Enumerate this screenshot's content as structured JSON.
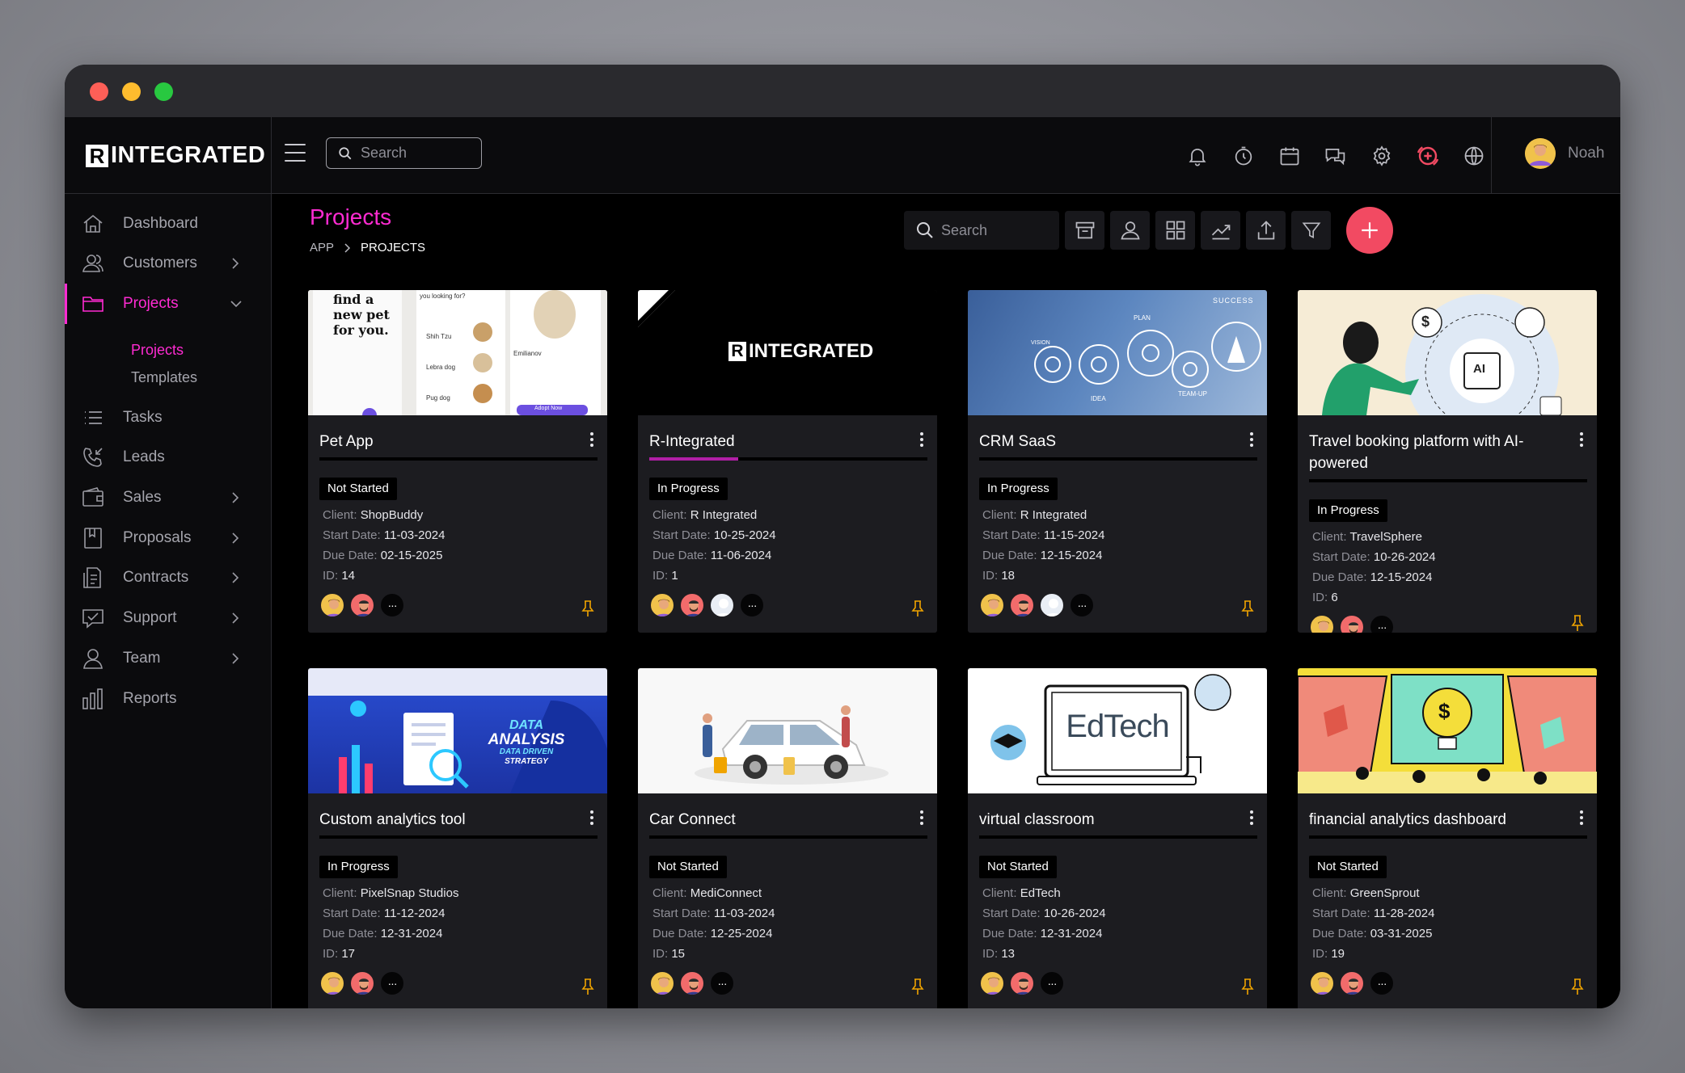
{
  "brand": {
    "mark": "R",
    "name": "INTEGRATED"
  },
  "header": {
    "search_placeholder": "Search",
    "user_name": "Noah",
    "icons": [
      "bell-icon",
      "timer-icon",
      "calendar-icon",
      "chat-icon",
      "gear-icon",
      "add-circle-icon",
      "globe-icon"
    ]
  },
  "sidebar": {
    "items": [
      {
        "label": "Dashboard",
        "icon": "home-icon"
      },
      {
        "label": "Customers",
        "icon": "users-icon"
      },
      {
        "label": "Projects",
        "icon": "folder-icon"
      },
      {
        "label": "Tasks",
        "icon": "list-icon"
      },
      {
        "label": "Leads",
        "icon": "phone-incoming-icon"
      },
      {
        "label": "Sales",
        "icon": "wallet-icon"
      },
      {
        "label": "Proposals",
        "icon": "bookmark-doc-icon"
      },
      {
        "label": "Contracts",
        "icon": "contract-icon"
      },
      {
        "label": "Support",
        "icon": "support-chat-icon"
      },
      {
        "label": "Team",
        "icon": "person-icon"
      },
      {
        "label": "Reports",
        "icon": "bar-chart-icon"
      }
    ],
    "projects_sub": [
      "Projects",
      "Templates"
    ],
    "accent": "#ff2bd2"
  },
  "page": {
    "title": "Projects",
    "breadcrumb": [
      "APP",
      "PROJECTS"
    ],
    "search_placeholder": "Search",
    "toolbar_icons": [
      "archive-icon",
      "person-icon",
      "grid-icon",
      "trend-icon",
      "upload-icon",
      "filter-icon",
      "plus-icon"
    ]
  },
  "labels": {
    "client": "Client:",
    "start": "Start Date:",
    "due": "Due Date:",
    "id": "ID:",
    "more": "···"
  },
  "projects": [
    {
      "title": "Pet App",
      "status": "Not Started",
      "client": "ShopBuddy",
      "start": "11-03-2024",
      "due": "02-15-2025",
      "id": "14",
      "progress": 0
    },
    {
      "title": "R-Integrated",
      "status": "In Progress",
      "client": "R Integrated",
      "start": "10-25-2024",
      "due": "11-06-2024",
      "id": "1",
      "progress": 0.32
    },
    {
      "title": "CRM SaaS",
      "status": "In Progress",
      "client": "R Integrated",
      "start": "11-15-2024",
      "due": "12-15-2024",
      "id": "18",
      "progress": 0
    },
    {
      "title": "Travel booking platform with AI-powered",
      "status": "In Progress",
      "client": "TravelSphere",
      "start": "10-26-2024",
      "due": "12-15-2024",
      "id": "6",
      "progress": 0
    },
    {
      "title": "Custom analytics tool",
      "status": "In Progress",
      "client": "PixelSnap Studios",
      "start": "11-12-2024",
      "due": "12-31-2024",
      "id": "17",
      "progress": 0
    },
    {
      "title": "Car Connect",
      "status": "Not Started",
      "client": "MediConnect",
      "start": "11-03-2024",
      "due": "12-25-2024",
      "id": "15",
      "progress": 0
    },
    {
      "title": "virtual classroom",
      "status": "Not Started",
      "client": "EdTech",
      "start": "10-26-2024",
      "due": "12-31-2024",
      "id": "13",
      "progress": 0
    },
    {
      "title": "financial analytics dashboard",
      "status": "Not Started",
      "client": "GreenSprout",
      "start": "11-28-2024",
      "due": "03-31-2025",
      "id": "19",
      "progress": 0
    }
  ],
  "thumbs": {
    "pet": {
      "headline": "find a new pet for you.",
      "sub": "you looking for?",
      "items": [
        "Shih Tzu",
        "Lebra dog",
        "Pug dog"
      ],
      "name": "Emilianov",
      "cta": "Adopt Now"
    },
    "rint": {
      "mark": "R",
      "name": "INTEGRATED"
    },
    "crm": {
      "words": [
        "SUCCESS",
        "PLAN",
        "IDEA",
        "TEAM-UP",
        "VISION"
      ]
    },
    "travel": {
      "chip": "AI",
      "currency": "$"
    },
    "analysis": {
      "line1": "DATA",
      "line2": "ANALYSIS",
      "line3": "DATA DRIVEN",
      "line4": "STRATEGY"
    },
    "edtech": {
      "text": "EdTech"
    },
    "finance": {
      "currency": "$"
    }
  }
}
